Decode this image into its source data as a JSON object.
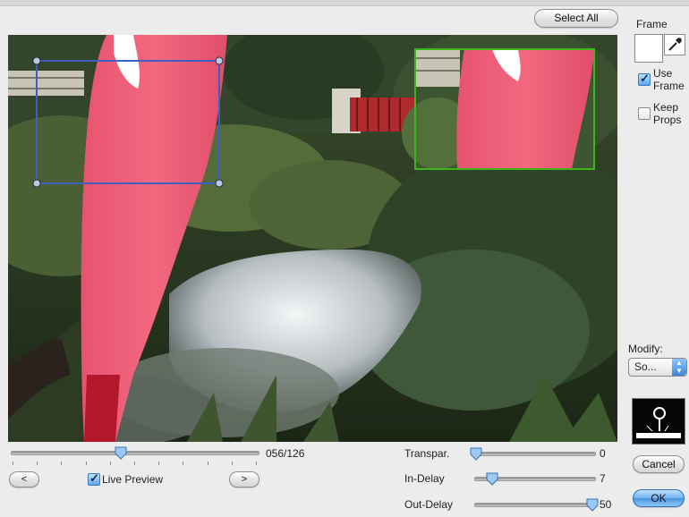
{
  "toolbar": {
    "select_all_label": "Select All"
  },
  "sidebar": {
    "frame_label": "Frame",
    "use_frame": {
      "label_line1": "Use",
      "label_line2": "Frame",
      "checked": true
    },
    "keep_props": {
      "label_line1": "Keep",
      "label_line2": "Props",
      "checked": false
    },
    "modify_label": "Modify:",
    "modify_value": "So..."
  },
  "timeline": {
    "counter": "056/126",
    "position_fraction": 0.444,
    "prev_label": "<",
    "next_label": ">",
    "live_preview_label": "Live Preview",
    "live_preview_checked": true
  },
  "params": {
    "transparency": {
      "label": "Transpar.",
      "value": "0",
      "fraction": 0.0
    },
    "in_delay": {
      "label": "In-Delay",
      "value": "7",
      "fraction": 0.14
    },
    "out_delay": {
      "label": "Out-Delay",
      "value": "50",
      "fraction": 1.0
    }
  },
  "actions": {
    "cancel_label": "Cancel",
    "ok_label": "OK"
  },
  "colors": {
    "selection_box": "#3e5fc0",
    "preview_box": "#3db51f",
    "flag": "#ef5f7c",
    "default_button": "#4b95de"
  }
}
